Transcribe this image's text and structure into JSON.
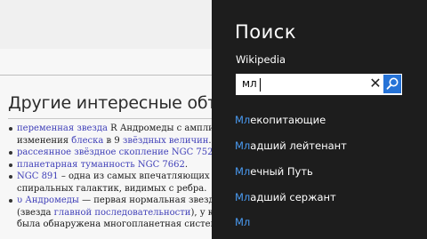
{
  "article": {
    "heading": "Другие интересные объект",
    "lines": [
      {
        "bullet": true,
        "parts": [
          {
            "t": "переменная звезда",
            "link": true
          },
          {
            "t": " R Андромеды с амплит",
            "link": false
          }
        ]
      },
      {
        "bullet": false,
        "parts": [
          {
            "t": "изменения ",
            "link": false
          },
          {
            "t": "блеска",
            "link": true
          },
          {
            "t": " в 9 ",
            "link": false
          },
          {
            "t": "звёздных величин",
            "link": true
          },
          {
            "t": ".",
            "link": false
          }
        ]
      },
      {
        "bullet": true,
        "parts": [
          {
            "t": "рассеянное звёздное скопление NGC 752",
            "link": true
          },
          {
            "t": ".",
            "link": false
          }
        ]
      },
      {
        "bullet": true,
        "parts": [
          {
            "t": "планетарная туманность NGC 7662",
            "link": true
          },
          {
            "t": ".",
            "link": false
          }
        ]
      },
      {
        "bullet": true,
        "parts": [
          {
            "t": "NGC 891",
            "link": true
          },
          {
            "t": " – одна из самых впечатляющих",
            "link": false
          }
        ]
      },
      {
        "bullet": false,
        "parts": [
          {
            "t": "спиральных галактик, видимых с ребра.",
            "link": false
          }
        ]
      },
      {
        "bullet": true,
        "parts": [
          {
            "t": "υ Андромеды",
            "link": true
          },
          {
            "t": " — первая нормальная звезд",
            "link": false
          }
        ]
      },
      {
        "bullet": false,
        "parts": [
          {
            "t": "(звезда ",
            "link": false
          },
          {
            "t": "главной последовательности",
            "link": true
          },
          {
            "t": "), у ко",
            "link": false
          }
        ]
      },
      {
        "bullet": false,
        "parts": [
          {
            "t": "была обнаружена многопланетная систем",
            "link": false
          }
        ]
      }
    ]
  },
  "search": {
    "title": "Поиск",
    "app_name": "Wikipedia",
    "query": "мл",
    "clear_symbol": "✕",
    "suggestions": [
      {
        "prefix": "Мл",
        "rest": "екопитающие"
      },
      {
        "prefix": "Мл",
        "rest": "адший лейтенант"
      },
      {
        "prefix": "Мл",
        "rest": "ечный Путь"
      },
      {
        "prefix": "Мл",
        "rest": "адший сержант"
      },
      {
        "prefix": "Мл",
        "rest": ""
      }
    ],
    "accent_color": "#2673d7"
  }
}
